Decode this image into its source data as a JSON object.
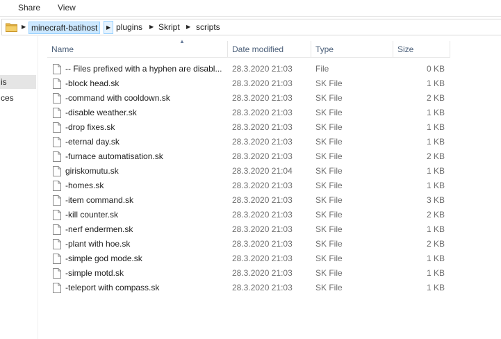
{
  "ribbon": {
    "tabs": [
      "Share",
      "View"
    ]
  },
  "address": {
    "crumbs": [
      "minecraft-batihost",
      "plugins",
      "Skript",
      "scripts"
    ]
  },
  "navpane": {
    "items": [
      "is",
      "ces"
    ]
  },
  "columns": {
    "name": "Name",
    "date": "Date modified",
    "type": "Type",
    "size": "Size"
  },
  "files": [
    {
      "name": "-- Files prefixed with a hyphen are disabl...",
      "date": "28.3.2020 21:03",
      "type": "File",
      "size": "0 KB"
    },
    {
      "name": "-block head.sk",
      "date": "28.3.2020 21:03",
      "type": "SK File",
      "size": "1 KB"
    },
    {
      "name": "-command with cooldown.sk",
      "date": "28.3.2020 21:03",
      "type": "SK File",
      "size": "2 KB"
    },
    {
      "name": "-disable weather.sk",
      "date": "28.3.2020 21:03",
      "type": "SK File",
      "size": "1 KB"
    },
    {
      "name": "-drop fixes.sk",
      "date": "28.3.2020 21:03",
      "type": "SK File",
      "size": "1 KB"
    },
    {
      "name": "-eternal day.sk",
      "date": "28.3.2020 21:03",
      "type": "SK File",
      "size": "1 KB"
    },
    {
      "name": "-furnace automatisation.sk",
      "date": "28.3.2020 21:03",
      "type": "SK File",
      "size": "2 KB"
    },
    {
      "name": "giriskomutu.sk",
      "date": "28.3.2020 21:04",
      "type": "SK File",
      "size": "1 KB"
    },
    {
      "name": "-homes.sk",
      "date": "28.3.2020 21:03",
      "type": "SK File",
      "size": "1 KB"
    },
    {
      "name": "-item command.sk",
      "date": "28.3.2020 21:03",
      "type": "SK File",
      "size": "3 KB"
    },
    {
      "name": "-kill counter.sk",
      "date": "28.3.2020 21:03",
      "type": "SK File",
      "size": "2 KB"
    },
    {
      "name": "-nerf endermen.sk",
      "date": "28.3.2020 21:03",
      "type": "SK File",
      "size": "1 KB"
    },
    {
      "name": "-plant with hoe.sk",
      "date": "28.3.2020 21:03",
      "type": "SK File",
      "size": "2 KB"
    },
    {
      "name": "-simple god mode.sk",
      "date": "28.3.2020 21:03",
      "type": "SK File",
      "size": "1 KB"
    },
    {
      "name": "-simple motd.sk",
      "date": "28.3.2020 21:03",
      "type": "SK File",
      "size": "1 KB"
    },
    {
      "name": "-teleport with compass.sk",
      "date": "28.3.2020 21:03",
      "type": "SK File",
      "size": "1 KB"
    }
  ]
}
